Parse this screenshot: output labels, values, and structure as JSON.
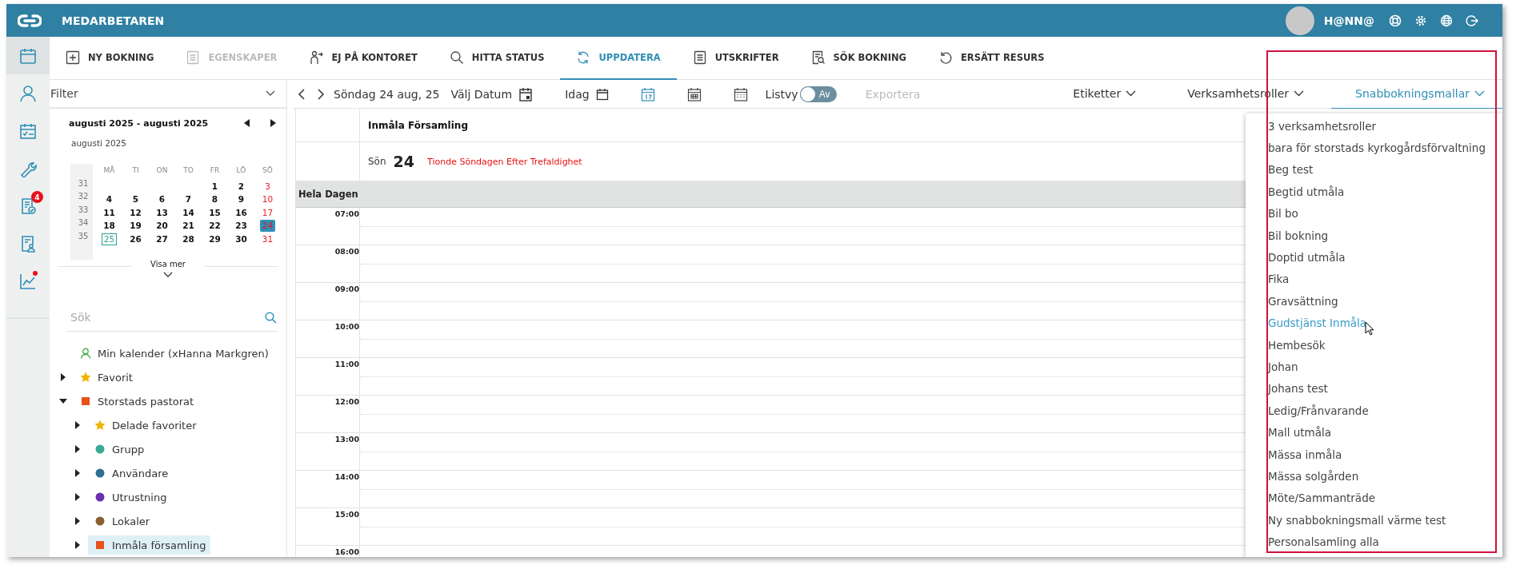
{
  "topbar": {
    "title": "MEDARBETAREN",
    "user": "H@NN@"
  },
  "rail": [
    {
      "selected": true,
      "dot": false
    },
    {
      "selected": false,
      "dot": false
    },
    {
      "selected": false,
      "dot": false
    },
    {
      "selected": false,
      "dot": false
    },
    {
      "selected": false,
      "dot": false,
      "badge": "4"
    },
    {
      "selected": false,
      "dot": false
    },
    {
      "selected": false,
      "dot": true
    }
  ],
  "toolbar": [
    {
      "label": "NY BOKNING",
      "disabled": false,
      "selected": false
    },
    {
      "label": "EGENSKAPER",
      "disabled": true,
      "selected": false
    },
    {
      "label": "EJ PÅ KONTORET",
      "disabled": false,
      "selected": false
    },
    {
      "label": "HITTA STATUS",
      "disabled": false,
      "selected": false
    },
    {
      "label": "UPPDATERA",
      "disabled": false,
      "selected": true
    },
    {
      "label": "UTSKRIFTER",
      "disabled": false,
      "selected": false
    },
    {
      "label": "SÖK BOKNING",
      "disabled": false,
      "selected": false
    },
    {
      "label": "ERSÄTT RESURS",
      "disabled": false,
      "selected": false
    }
  ],
  "filter": {
    "label": "Filter"
  },
  "mini_calendar": {
    "range": "augusti 2025 - augusti 2025",
    "month": "augusti 2025",
    "weekdays": [
      "MÅ",
      "TI",
      "ON",
      "TO",
      "FR",
      "LÖ",
      "SÖ"
    ],
    "weeks": [
      {
        "week": "31",
        "days": [
          {
            "n": "1",
            "selected": false,
            "today": false
          },
          {
            "n": "2",
            "selected": false,
            "today": false
          },
          {
            "n": "3",
            "selected": false,
            "today": false
          }
        ]
      },
      {
        "week": "32",
        "days": [
          {
            "n": "4",
            "selected": false,
            "today": false
          },
          {
            "n": "5",
            "selected": false,
            "today": false
          },
          {
            "n": "6",
            "selected": false,
            "today": false
          },
          {
            "n": "7",
            "selected": false,
            "today": false
          },
          {
            "n": "8",
            "selected": false,
            "today": false
          },
          {
            "n": "9",
            "selected": false,
            "today": false
          },
          {
            "n": "10",
            "selected": false,
            "today": false
          }
        ]
      },
      {
        "week": "33",
        "days": [
          {
            "n": "11",
            "selected": false,
            "today": false
          },
          {
            "n": "12",
            "selected": false,
            "today": false
          },
          {
            "n": "13",
            "selected": false,
            "today": false
          },
          {
            "n": "14",
            "selected": false,
            "today": false
          },
          {
            "n": "15",
            "selected": false,
            "today": false
          },
          {
            "n": "16",
            "selected": false,
            "today": false
          },
          {
            "n": "17",
            "selected": false,
            "today": false
          }
        ]
      },
      {
        "week": "34",
        "days": [
          {
            "n": "18",
            "selected": false,
            "today": false
          },
          {
            "n": "19",
            "selected": false,
            "today": false
          },
          {
            "n": "20",
            "selected": false,
            "today": false
          },
          {
            "n": "21",
            "selected": false,
            "today": false
          },
          {
            "n": "22",
            "selected": false,
            "today": false
          },
          {
            "n": "23",
            "selected": false,
            "today": false
          },
          {
            "n": "24",
            "selected": true,
            "today": false
          }
        ]
      },
      {
        "week": "35",
        "days": [
          {
            "n": "25",
            "selected": false,
            "today": true
          },
          {
            "n": "26",
            "selected": false,
            "today": false
          },
          {
            "n": "27",
            "selected": false,
            "today": false
          },
          {
            "n": "28",
            "selected": false,
            "today": false
          },
          {
            "n": "29",
            "selected": false,
            "today": false
          },
          {
            "n": "30",
            "selected": false,
            "today": false
          },
          {
            "n": "31",
            "selected": false,
            "today": false
          }
        ]
      }
    ],
    "more": "Visa mer"
  },
  "search": {
    "placeholder": "Sök"
  },
  "tree": {
    "items": [
      {
        "label": "Min kalender (xHanna Markgren)",
        "kind": "person",
        "color": "#4caf50",
        "selected": false
      },
      {
        "label": "Favorit",
        "kind": "star",
        "color": "#f0b400",
        "expanded": false,
        "selected": false
      },
      {
        "label": "Storstads pastorat",
        "kind": "square",
        "color": "#e8501e",
        "expanded": true,
        "selected": false,
        "children": [
          {
            "label": "Delade favoriter",
            "kind": "star",
            "color": "#f0b400",
            "expanded": false,
            "selected": false
          },
          {
            "label": "Grupp",
            "kind": "dot",
            "color": "#3aaa95",
            "expanded": false,
            "selected": false
          },
          {
            "label": "Användare",
            "kind": "dot",
            "color": "#2f6f95",
            "expanded": false,
            "selected": false
          },
          {
            "label": "Utrustning",
            "kind": "dot",
            "color": "#6a2fb0",
            "expanded": false,
            "selected": false
          },
          {
            "label": "Lokaler",
            "kind": "dot",
            "color": "#8a6030",
            "expanded": false,
            "selected": false
          },
          {
            "label": "Inmåla församling",
            "kind": "square",
            "color": "#e8501e",
            "expanded": false,
            "selected": true
          }
        ]
      }
    ]
  },
  "nav": {
    "date": "Söndag 24 aug, 25",
    "pick_date": "Välj Datum",
    "today": "Idag",
    "views": [
      {
        "kind": "day",
        "selected": true
      },
      {
        "kind": "week",
        "selected": false
      },
      {
        "kind": "month",
        "selected": false
      }
    ],
    "list_label": "Listvy",
    "list_toggle": {
      "on": false,
      "label": "Av"
    },
    "export": {
      "label": "Exportera",
      "disabled": true
    },
    "filters": [
      {
        "label": "Etiketter",
        "open": false
      },
      {
        "label": "Verksamhetsroller",
        "open": false
      },
      {
        "label": "Snabbokningsmallar",
        "open": true
      }
    ]
  },
  "calendar": {
    "resource": "Inmåla Församling",
    "weekday": "Sön",
    "day": "24",
    "holiday": "Tionde Söndagen Efter Trefaldighet",
    "all_day": "Hela Dagen",
    "hours": [
      "07:00",
      "08:00",
      "09:00",
      "10:00",
      "11:00",
      "12:00",
      "13:00",
      "14:00",
      "15:00",
      "16:00"
    ]
  },
  "quick_templates": {
    "items": [
      {
        "label": "3 verksamhetsroller",
        "hovered": false
      },
      {
        "label": "bara för storstads kyrkogårdsförvaltning",
        "hovered": false
      },
      {
        "label": "Beg test",
        "hovered": false
      },
      {
        "label": "Begtid utmåla",
        "hovered": false
      },
      {
        "label": "Bil bo",
        "hovered": false
      },
      {
        "label": "Bil bokning",
        "hovered": false
      },
      {
        "label": "Doptid utmåla",
        "hovered": false
      },
      {
        "label": "Fika",
        "hovered": false
      },
      {
        "label": "Gravsättning",
        "hovered": false
      },
      {
        "label": "Gudstjänst Inmåla",
        "hovered": true
      },
      {
        "label": "Hembesök",
        "hovered": false
      },
      {
        "label": "Johan",
        "hovered": false
      },
      {
        "label": "Johans test",
        "hovered": false
      },
      {
        "label": "Ledig/Frånvarande",
        "hovered": false
      },
      {
        "label": "Mall utmåla",
        "hovered": false
      },
      {
        "label": "Mässa inmåla",
        "hovered": false
      },
      {
        "label": "Mässa solgården",
        "hovered": false
      },
      {
        "label": "Möte/Sammanträde",
        "hovered": false
      },
      {
        "label": "Ny snabbokningsmall värme test",
        "hovered": false
      },
      {
        "label": "Personalsamling alla",
        "hovered": false
      }
    ]
  }
}
